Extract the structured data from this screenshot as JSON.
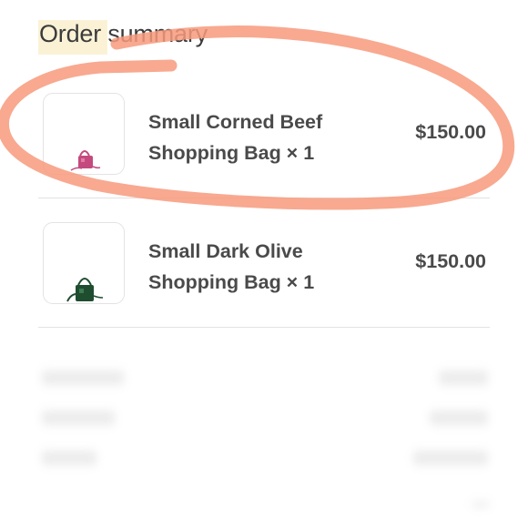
{
  "order_summary": {
    "title": "Order summary",
    "items": [
      {
        "name_line1": "Small Corned Beef",
        "name_line2": "Shopping Bag × 1",
        "price": "$150.00",
        "thumb_color": "#c44a7e",
        "thumb_icon": "pink-bag-icon"
      },
      {
        "name_line1": "Small Dark Olive",
        "name_line2": "Shopping Bag × 1",
        "price": "$150.00",
        "thumb_color": "#1f4d2f",
        "thumb_icon": "green-bag-icon"
      }
    ]
  },
  "annotation": {
    "color": "#f79a7d"
  }
}
